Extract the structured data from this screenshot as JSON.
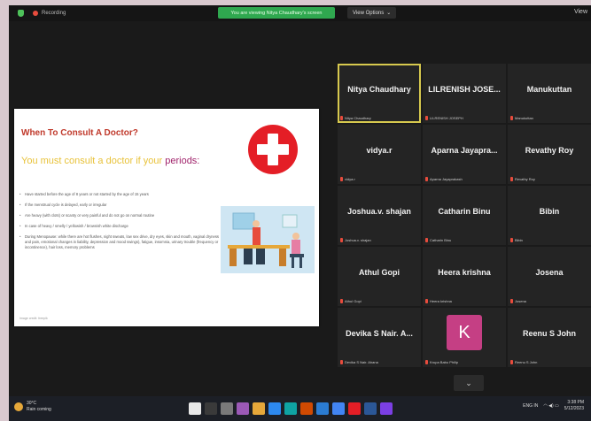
{
  "topbar": {
    "recording_label": "Recording",
    "viewing_banner": "You are viewing Nitya Chaudhary's screen",
    "view_options": "View Options",
    "view_options_caret": "⌄",
    "view_label": "View"
  },
  "slide": {
    "title": "When To Consult A Doctor?",
    "subtitle_prefix": "You must consult a doctor if your ",
    "subtitle_highlight": "periods:",
    "bullets": [
      "Have started before the age of 8 years or not started by the age of 15 years",
      "If the menstrual cycle is delayed, early or irregular",
      "Are heavy (with clots) or scanty or very painful and do not go on normal routine",
      "In case of heavy / smelly / yellowish / brownish white discharge",
      "During Menopause: while there are hot flushes, night sweats, low sex drive, dry eyes, skin and mouth, vaginal dryness and pain, emotional changes in liability, depression and mood swings), fatigue, insomnia, urinary trouble (frequency or incontinence), hair loss, memory problems"
    ],
    "footnote": "Image credit: freepik"
  },
  "participants": [
    {
      "name": "Nitya Chaudhary",
      "label": "Nitya Chaudhary",
      "active": true
    },
    {
      "name": "LILRENISH JOSE...",
      "label": "LILRENISH JOSEPH"
    },
    {
      "name": "Manukuttan",
      "label": "Manukuttan"
    },
    {
      "name": "vidya.r",
      "label": "vidya.r"
    },
    {
      "name": "Aparna Jayapra...",
      "label": "Aparna Jayaprakash"
    },
    {
      "name": "Revathy Roy",
      "label": "Revathy Roy"
    },
    {
      "name": "Joshua.v. shajan",
      "label": "Joshua.v. shajan"
    },
    {
      "name": "Catharin Binu",
      "label": "Catharin Binu"
    },
    {
      "name": "Bibin",
      "label": "Bibin"
    },
    {
      "name": "Athul Gopi",
      "label": "Athul Gopi"
    },
    {
      "name": "Heera krishna",
      "label": "Heera krishna"
    },
    {
      "name": "Josena",
      "label": "Josena"
    },
    {
      "name": "Devika S Nair. A...",
      "label": "Devika S Nair. Ahana"
    },
    {
      "name": "",
      "label": "Krupa Babu Philip",
      "avatar": "K"
    },
    {
      "name": "Reenu S John",
      "label": "Reenu S John"
    }
  ],
  "more_button": "⌄",
  "taskbar": {
    "weather_temp": "30°C",
    "weather_desc": "Rain coming",
    "tray_lang": "ENG IN",
    "tray_icons": "◠ ◀) ▭",
    "time": "3:38 PM",
    "date": "5/12/2023"
  },
  "colors": {
    "taskbar_icons": [
      "#e8e8e8",
      "#3a3a3a",
      "#7a7a7a",
      "#9b59b6",
      "#e6a83a",
      "#2d89ef",
      "#0fa3a3",
      "#d04a02",
      "#2b7cd3",
      "#4285f4",
      "#e41e26",
      "#2b5797",
      "#7b3fe4"
    ]
  }
}
